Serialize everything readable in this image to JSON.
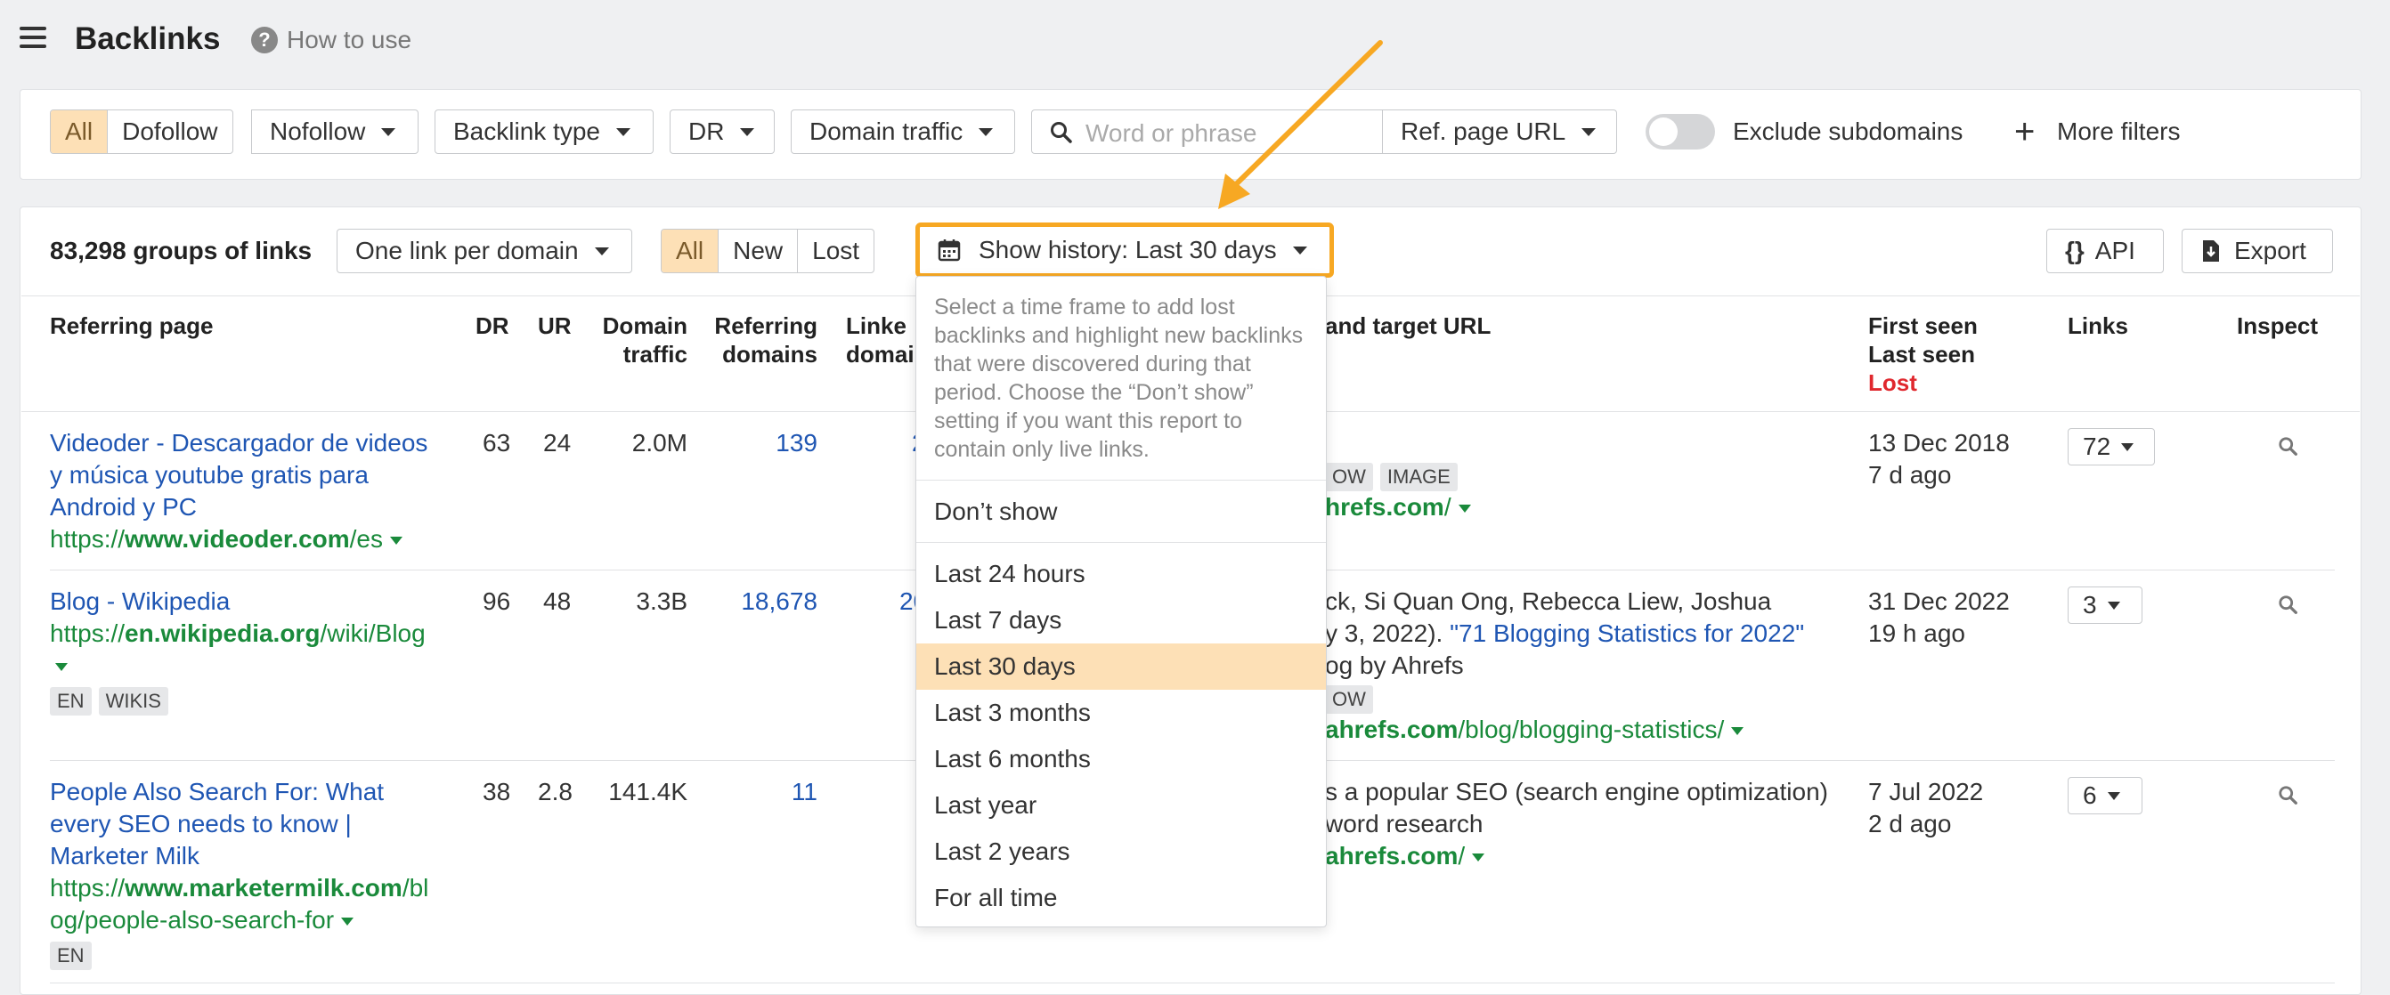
{
  "header": {
    "title": "Backlinks",
    "help_label": "How to use"
  },
  "filters": {
    "link_types": [
      "All",
      "Dofollow"
    ],
    "nofollow": "Nofollow",
    "backlink_type": "Backlink type",
    "dr": "DR",
    "domain_traffic": "Domain traffic",
    "search_placeholder": "Word or phrase",
    "ref_page_url": "Ref. page URL",
    "exclude_subdomains": "Exclude subdomains",
    "more_filters": "More filters"
  },
  "toolbar": {
    "groups_count": "83,298 groups of links",
    "grouping": "One link per domain",
    "status_tabs": [
      "All",
      "New",
      "Lost"
    ],
    "history_button": "Show history: Last 30 days",
    "api": "API",
    "export": "Export"
  },
  "table": {
    "headers": {
      "referring_page": "Referring page",
      "dr": "DR",
      "ur": "UR",
      "domain_traffic_1": "Domain",
      "domain_traffic_2": "traffic",
      "referring_domains_1": "Referring",
      "referring_domains_2": "domains",
      "linked_domains_1": "Linke",
      "linked_domains_2": "domai",
      "anchor_target": "and target URL",
      "first_seen": "First seen",
      "last_seen": "Last seen",
      "lost": "Lost",
      "links": "Links",
      "inspect": "Inspect"
    },
    "rows": [
      {
        "title_lines": [
          "Videoder - Descargador de videos",
          "y música youtube gratis para",
          "Android y PC"
        ],
        "url_prefix": "https://",
        "url_domain": "www.videoder.com",
        "url_path": "/es",
        "dr": "63",
        "ur": "24",
        "traffic": "2.0M",
        "ref_domains": "139",
        "linked_domains": "2",
        "anchor_tags": [
          "OW",
          "IMAGE"
        ],
        "target_domain": "hrefs.com",
        "target_path": "/",
        "first_seen": "13 Dec 2018",
        "last_seen": "7 d ago",
        "links": "72"
      },
      {
        "title_lines": [
          "Blog - Wikipedia"
        ],
        "url_prefix": "https://",
        "url_domain": "en.wikipedia.org",
        "url_path": "/wiki/Blog",
        "tags": [
          "EN",
          "WIKIS"
        ],
        "dr": "96",
        "ur": "48",
        "traffic": "3.3B",
        "ref_domains": "18,678",
        "linked_domains": "20",
        "anchor_line1": "ck, Si Quan Ong, Rebecca Liew, Joshua",
        "anchor_line2_pre": "y 3, 2022). ",
        "anchor_line2_link": "\"71 Blogging Statistics for 2022\"",
        "anchor_line3": "og by Ahrefs",
        "anchor_tag": "OW",
        "target_domain": "ahrefs.com",
        "target_path": "/blog/blogging-statistics/",
        "first_seen": "31 Dec 2022",
        "last_seen": "19 h ago",
        "links": "3"
      },
      {
        "title_lines": [
          "People Also Search For: What",
          "every SEO needs to know |",
          "Marketer Milk"
        ],
        "url_prefix": "https://",
        "url_domain": "www.marketermilk.com",
        "url_path_1": "/bl",
        "url_path_2": "og/people-also-search-for",
        "tags": [
          "EN"
        ],
        "dr": "38",
        "ur": "2.8",
        "traffic": "141.4K",
        "ref_domains": "11",
        "anchor_line1": "s a popular SEO (search engine optimization)",
        "anchor_line2": "word research",
        "target_domain": "ahrefs.com",
        "target_path": "/",
        "first_seen": "7 Jul 2022",
        "last_seen": "2 d ago",
        "links": "6"
      }
    ]
  },
  "history_dropdown": {
    "description": "Select a time frame to add lost backlinks and highlight new backlinks that were discovered during that period. Choose the “Don’t show” setting if you want this report to contain only live links.",
    "dont_show": "Don’t show",
    "options": [
      "Last 24 hours",
      "Last 7 days",
      "Last 30 days",
      "Last 3 months",
      "Last 6 months",
      "Last year",
      "Last 2 years",
      "For all time"
    ],
    "selected": "Last 30 days"
  },
  "colors": {
    "accent": "#fde0b6",
    "highlight": "#f7a823",
    "link": "#1f56b3",
    "url": "#1a8a3b",
    "lost": "#e0282e"
  }
}
